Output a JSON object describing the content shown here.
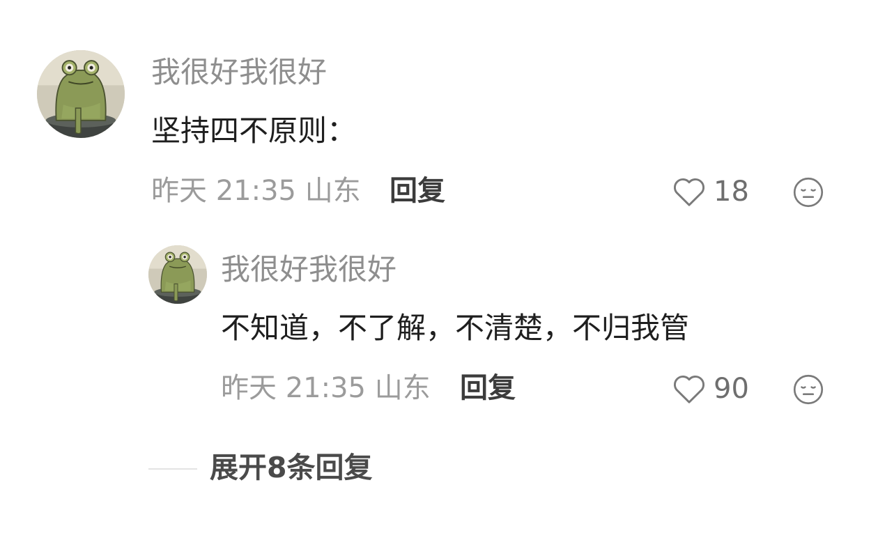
{
  "comments": [
    {
      "avatar_icon": "frog-avatar",
      "username": "我很好我很好",
      "text": "坚持四不原则：",
      "meta": "昨天 21:35 山东",
      "reply_label": "回复",
      "likes": "18",
      "like_icon": "heart-outline-icon",
      "dislike_icon": "neutral-face-icon"
    },
    {
      "avatar_icon": "frog-avatar",
      "username": "我很好我很好",
      "text": "不知道，不了解，不清楚，不归我管",
      "meta": "昨天 21:35 山东",
      "reply_label": "回复",
      "likes": "90",
      "like_icon": "heart-outline-icon",
      "dislike_icon": "neutral-face-icon"
    }
  ],
  "expand_replies": {
    "label": "展开8条回复"
  },
  "colors": {
    "background": "#ffffff",
    "username": "#8e8e8e",
    "text": "#1e1e1e",
    "meta": "#9b9b9b",
    "reply": "#3c3c3c",
    "icon": "#7a7a7a"
  }
}
